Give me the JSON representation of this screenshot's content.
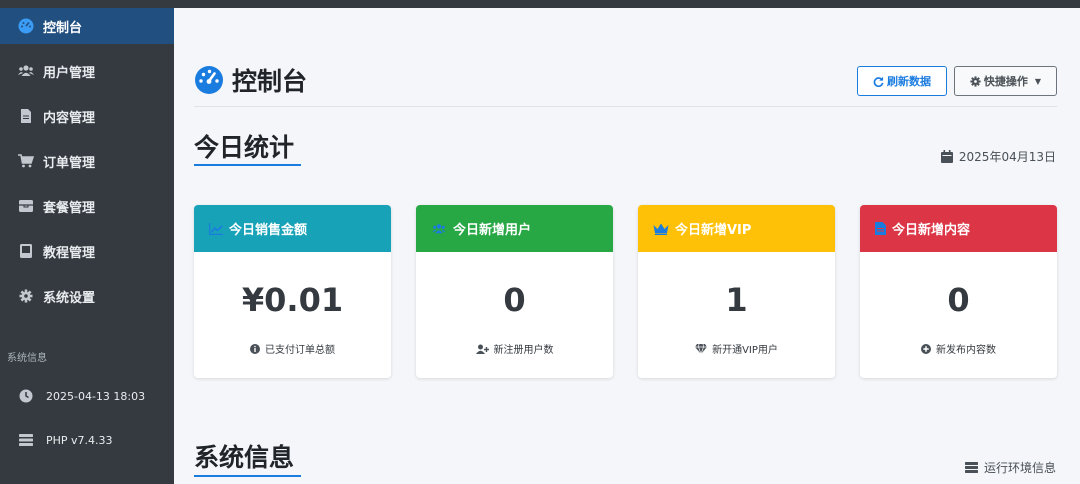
{
  "sidebar": {
    "items": [
      {
        "label": "控制台",
        "icon": "dashboard-icon"
      },
      {
        "label": "用户管理",
        "icon": "users-icon"
      },
      {
        "label": "内容管理",
        "icon": "file-icon"
      },
      {
        "label": "订单管理",
        "icon": "cart-icon"
      },
      {
        "label": "套餐管理",
        "icon": "package-icon"
      },
      {
        "label": "教程管理",
        "icon": "book-icon"
      },
      {
        "label": "系统设置",
        "icon": "gear-icon"
      }
    ],
    "system_label": "系统信息",
    "system_items": [
      {
        "label": "2025-04-13 18:03",
        "icon": "clock-icon"
      },
      {
        "label": "PHP v7.4.33",
        "icon": "server-icon"
      }
    ]
  },
  "header": {
    "title": "控制台",
    "refresh_label": "刷新数据",
    "quick_label": "快捷操作"
  },
  "today": {
    "title": "今日统计",
    "date": "2025年04月13日",
    "cards": [
      {
        "title": "今日销售金额",
        "value": "¥0.01",
        "note": "已支付订单总额",
        "color": "#17a2b8"
      },
      {
        "title": "今日新增用户",
        "value": "0",
        "note": "新注册用户数",
        "color": "#28a745"
      },
      {
        "title": "今日新增VIP",
        "value": "1",
        "note": "新开通VIP用户",
        "color": "#ffc107"
      },
      {
        "title": "今日新增内容",
        "value": "0",
        "note": "新发布内容数",
        "color": "#dc3545"
      }
    ]
  },
  "system": {
    "title": "系统信息",
    "env_label": "运行环境信息"
  }
}
